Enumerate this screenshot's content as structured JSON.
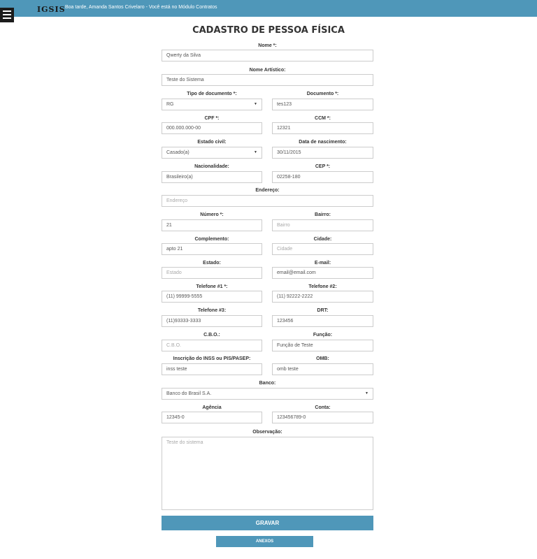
{
  "header": {
    "logo": "IGSIS",
    "greeting": "Boa tarde, Amanda Santos Crivelaro - Você está no Módulo Contratos"
  },
  "form": {
    "title": "CADASTRO DE PESSOA FÍSICA",
    "nome": {
      "label": "Nome *:",
      "value": "Qwerty da Silva"
    },
    "nome_artistico": {
      "label": "Nome Artístico:",
      "value": "Teste do Sistema"
    },
    "tipo_documento": {
      "label": "Tipo de documento *:",
      "value": "RG"
    },
    "documento": {
      "label": "Documento *:",
      "value": "tes123"
    },
    "cpf": {
      "label": "CPF *:",
      "value": "000.000.000-00"
    },
    "ccm": {
      "label": "CCM *:",
      "value": "12321"
    },
    "estado_civil": {
      "label": "Estado civil:",
      "value": "Casado(a)"
    },
    "data_nascimento": {
      "label": "Data de nascimento:",
      "value": "30/11/2015"
    },
    "nacionalidade": {
      "label": "Nacionalidade:",
      "value": "Brasileiro(a)"
    },
    "cep": {
      "label": "CEP *:",
      "value": "02258-180"
    },
    "endereco": {
      "label": "Endereço:",
      "placeholder": "Endereço"
    },
    "numero": {
      "label": "Número *:",
      "value": "21"
    },
    "bairro": {
      "label": "Bairro:",
      "placeholder": "Bairro"
    },
    "complemento": {
      "label": "Complemento:",
      "value": "apto 21"
    },
    "cidade": {
      "label": "Cidade:",
      "placeholder": "Cidade"
    },
    "estado": {
      "label": "Estado:",
      "placeholder": "Estado"
    },
    "email": {
      "label": "E-mail:",
      "value": "email@email.com"
    },
    "telefone1": {
      "label": "Telefone #1 *:",
      "value": "(11) 99999-5555"
    },
    "telefone2": {
      "label": "Telefone #2:",
      "value": "(11) 92222-2222"
    },
    "telefone3": {
      "label": "Telefone #3:",
      "value": "(11)93333-3333"
    },
    "drt": {
      "label": "DRT:",
      "value": "123456"
    },
    "cbo": {
      "label": "C.B.O.:",
      "placeholder": "C.B.O."
    },
    "funcao": {
      "label": "Função:",
      "value": "Função de Teste"
    },
    "inss": {
      "label": "Inscrição do INSS ou PIS/PASEP:",
      "value": "inss teste"
    },
    "omb": {
      "label": "OMB:",
      "value": "omb teste"
    },
    "banco": {
      "label": "Banco:",
      "value": "Banco do Brasil S.A."
    },
    "agencia": {
      "label": "Agência",
      "value": "12345-0"
    },
    "conta": {
      "label": "Conta:",
      "value": "123456789-0"
    },
    "observacao": {
      "label": "Observação:",
      "value": "Teste do sistema"
    },
    "gravar_label": "GRAVAR",
    "anexos_label": "ANEXOS"
  },
  "colors": {
    "accent": "#4f97b9",
    "menu_button": "#1c1c1c",
    "border": "#cccccc",
    "placeholder": "#a8a8a8"
  }
}
